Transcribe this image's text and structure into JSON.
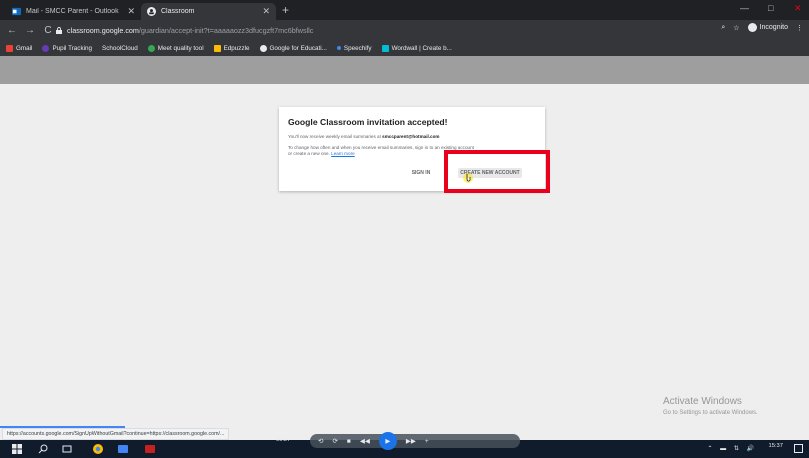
{
  "browser": {
    "tabs": [
      {
        "label": "Mail - SMCC Parent - Outlook",
        "active": false
      },
      {
        "label": "Classroom",
        "active": true
      }
    ],
    "new_tab_label": "+",
    "window_controls": {
      "minimize": "—",
      "maximize": "□",
      "close": "✕"
    },
    "nav": {
      "back": "←",
      "forward": "→",
      "reload": "C"
    },
    "url_host": "classroom.google.com",
    "url_path": "/guardian/accept-init?t=aaaaaozz3dfucgzft7mc6bfwsllc",
    "incognito_label": "Incognito",
    "bookmarks": [
      {
        "label": "Gmail",
        "color": "#ea4335"
      },
      {
        "label": "Pupil Tracking",
        "color": "#673ab7"
      },
      {
        "label": "SchoolCloud",
        "color": "#35363a"
      },
      {
        "label": "Meet quality tool",
        "color": "#34a853"
      },
      {
        "label": "Edpuzzle",
        "color": "#fbbc04"
      },
      {
        "label": "Google for Educati...",
        "color": "#e8eaed"
      },
      {
        "label": "Speechify",
        "color": "#4285f4"
      },
      {
        "label": "Wordwall | Create b...",
        "color": "#00bcd4"
      }
    ]
  },
  "dialog": {
    "title": "Google Classroom invitation accepted!",
    "line1_prefix": "You'll now receive weekly email summaries at ",
    "email": "smccparent@hotmail.com",
    "line2": "To change how often and when you receive email summaries, sign in to an existing account",
    "line3_prefix": "or create a new one. ",
    "learn_more": "Learn more",
    "sign_in_label": "SIGN IN",
    "create_account_label": "CREATE NEW ACCOUNT",
    "highlight_color": "#e8001c"
  },
  "watermark": {
    "title": "Activate Windows",
    "subtitle": "Go to Settings to activate Windows."
  },
  "status_url": "https://accounts.google.com/SignUpWithoutGmail?continue=https://classroom.google.com/...",
  "player": {
    "time": "00:27",
    "controls": [
      "⟲",
      "⟳",
      "■",
      "◀◀",
      "▶",
      "▶▶",
      "+"
    ]
  },
  "taskbar": {
    "clock": "15:37",
    "date": "",
    "tray": "⌃ ▬ ⇅ 🔊"
  }
}
